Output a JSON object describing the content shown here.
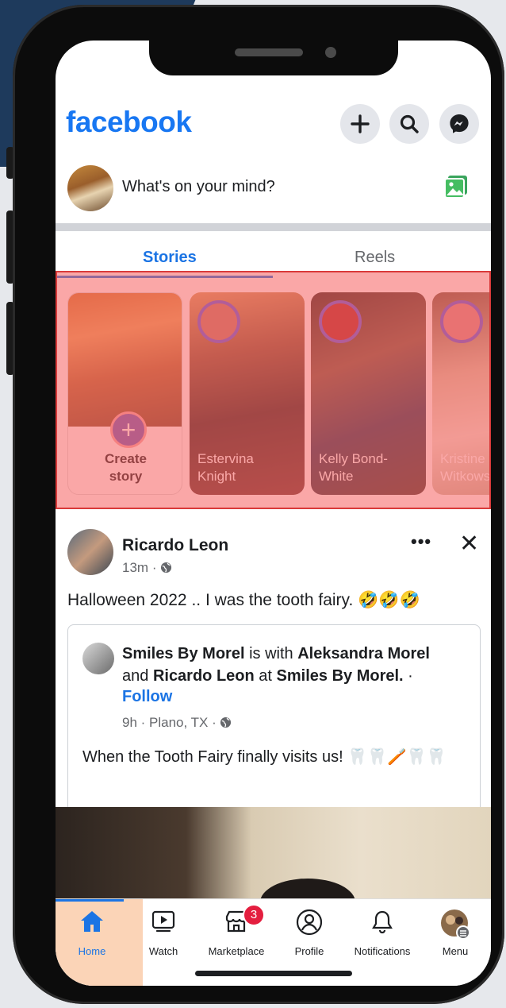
{
  "topbar": {
    "logo": "facebook",
    "icons": [
      "plus-icon",
      "search-icon",
      "messenger-icon"
    ]
  },
  "composer": {
    "placeholder": "What's on your mind?",
    "icon": "photo-icon"
  },
  "tabs": [
    {
      "label": "Stories",
      "active": true
    },
    {
      "label": "Reels",
      "active": false
    }
  ],
  "stories": {
    "create_label_line1": "Create",
    "create_label_line2": "story",
    "items": [
      {
        "name_line1": "Estervina",
        "name_line2": "Knight"
      },
      {
        "name_line1": "Kelly Bond-",
        "name_line2": "White"
      },
      {
        "name_line1": "Kristine",
        "name_line2": "Witkows"
      }
    ]
  },
  "post": {
    "author": "Ricardo Leon",
    "time": "13m",
    "text": "Halloween 2022 .. I was the tooth fairy. 🤣🤣🤣",
    "shared": {
      "page": "Smiles By Morel",
      "with_text": "is with",
      "person1": "Aleksandra Morel",
      "and_text": "and",
      "person2": "Ricardo Leon",
      "at_text": "at",
      "place": "Smiles By Morel.",
      "follow": "Follow",
      "meta": "9h · Plano, TX ·",
      "text": "When the Tooth Fairy finally visits us! 🦷🦷🪥🦷🦷"
    }
  },
  "navbar": {
    "items": [
      {
        "label": "Home",
        "icon": "home-icon"
      },
      {
        "label": "Watch",
        "icon": "watch-icon"
      },
      {
        "label": "Marketplace",
        "icon": "marketplace-icon",
        "badge": "3"
      },
      {
        "label": "Profile",
        "icon": "profile-icon"
      },
      {
        "label": "Notifications",
        "icon": "bell-icon"
      },
      {
        "label": "Menu",
        "icon": "menu-avatar-icon"
      }
    ]
  },
  "colors": {
    "brand": "#1877f2",
    "highlight_overlay": "#f55f5f",
    "badge": "#e41e3f"
  }
}
